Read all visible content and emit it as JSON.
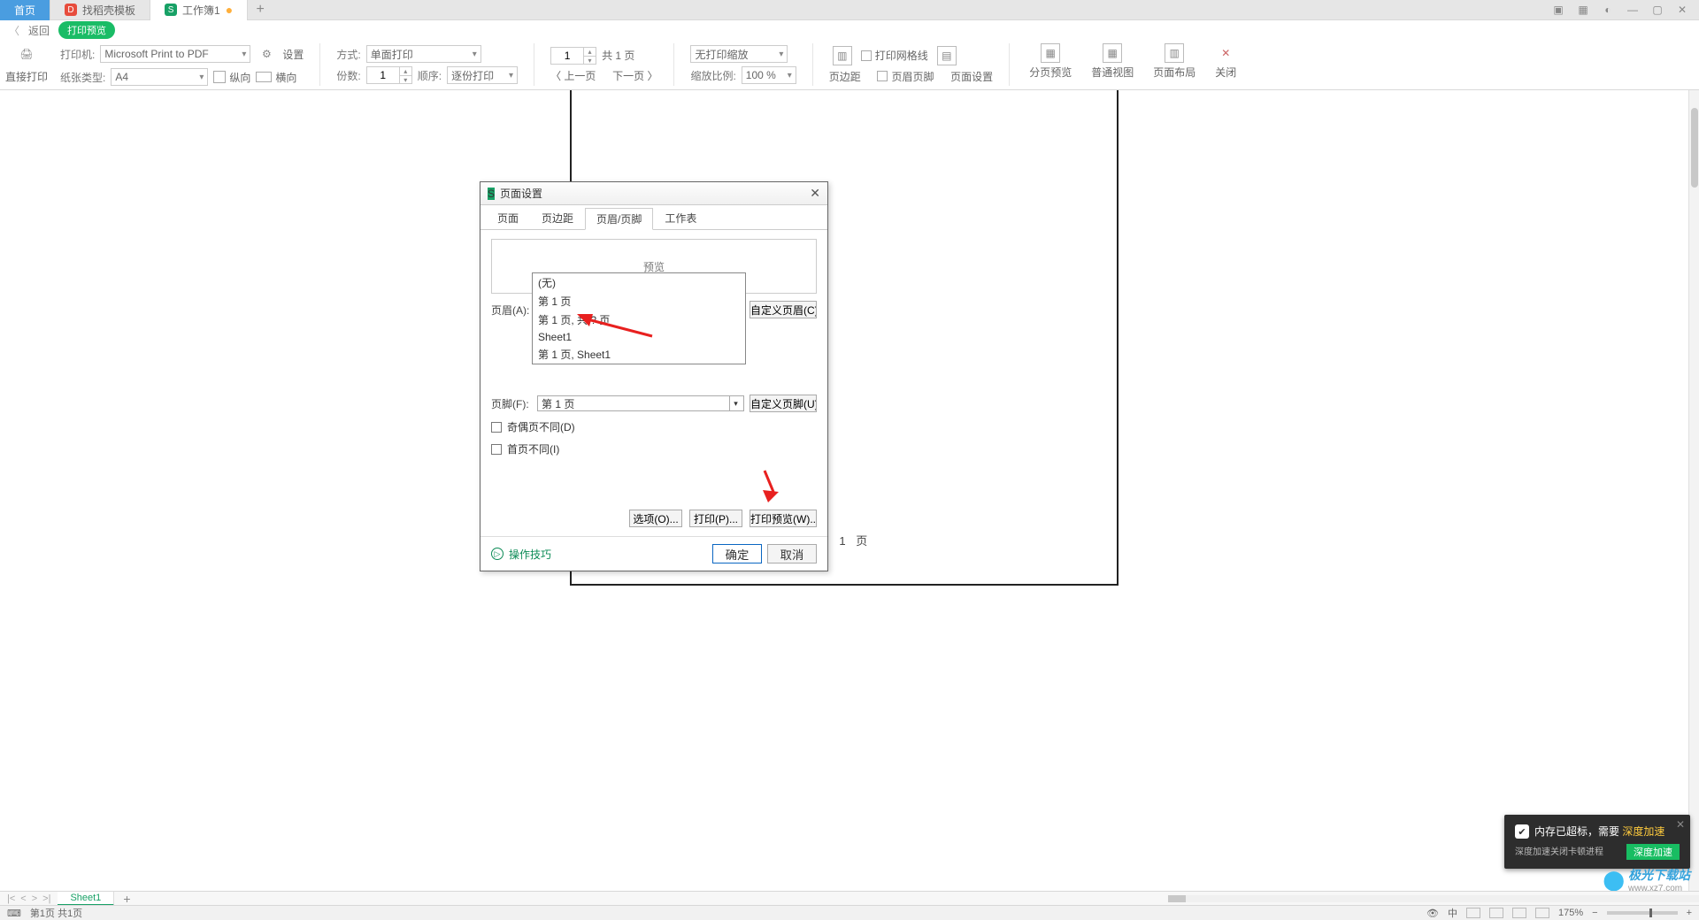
{
  "tabs": {
    "home": "首页",
    "template": "找稻壳模板",
    "workbook": "工作簿1"
  },
  "subhead": {
    "back": "返回",
    "badge": "打印预览"
  },
  "ribbon": {
    "printer_label": "打印机:",
    "printer_value": "Microsoft Print to PDF",
    "paper_label": "纸张类型:",
    "paper_value": "A4",
    "settings": "设置",
    "mode_label": "方式:",
    "mode_value": "单面打印",
    "copies_label": "份数:",
    "copies_value": "1",
    "order_label": "顺序:",
    "order_value": "逐份打印",
    "page_input": "1",
    "page_total": "共 1 页",
    "prev_page": "上一页",
    "next_page": "下一页",
    "zoom_mode": "无打印缩放",
    "zoom_label": "缩放比例:",
    "zoom_value": "100 %",
    "gridline": "打印网格线",
    "margin": "页边距",
    "headerfooter": "页眉页脚",
    "pagesetup": "页面设置",
    "breakview": "分页预览",
    "normalview": "普通视图",
    "pagelayout": "页面布局",
    "close": "关闭",
    "direct_print": "直接打印",
    "portrait": "纵向",
    "landscape": "横向"
  },
  "page": {
    "footer": "第 1 页"
  },
  "dialog": {
    "title": "页面设置",
    "tabs": [
      "页面",
      "页边距",
      "页眉/页脚",
      "工作表"
    ],
    "preview": "预览",
    "header_label": "页眉(A):",
    "header_value": "(无)",
    "custom_header": "自定义页眉(C)...",
    "footer_label": "页脚(F):",
    "footer_value": "第 1 页",
    "custom_footer": "自定义页脚(U)...",
    "header_options": [
      "(无)",
      "第 1 页",
      "第 1 页, 共 ? 页",
      "Sheet1",
      "第 1 页, Sheet1"
    ],
    "chk_oddeven": "奇偶页不同(D)",
    "chk_firstdiff": "首页不同(I)",
    "btn_options": "选项(O)...",
    "btn_print": "打印(P)...",
    "btn_preview": "打印预览(W)...",
    "hint": "操作技巧",
    "ok": "确定",
    "cancel": "取消"
  },
  "sheetbar": {
    "sheet": "Sheet1"
  },
  "status": {
    "page": "第1页 共1页",
    "zoom": "175%",
    "lang": "中"
  },
  "toast": {
    "title_a": "内存已超标，需要",
    "title_b": "深度加速",
    "sub": "深度加速关闭卡顿进程",
    "btn": "深度加速"
  },
  "logo": {
    "name": "极光下载站",
    "url": "www.xz7.com"
  }
}
